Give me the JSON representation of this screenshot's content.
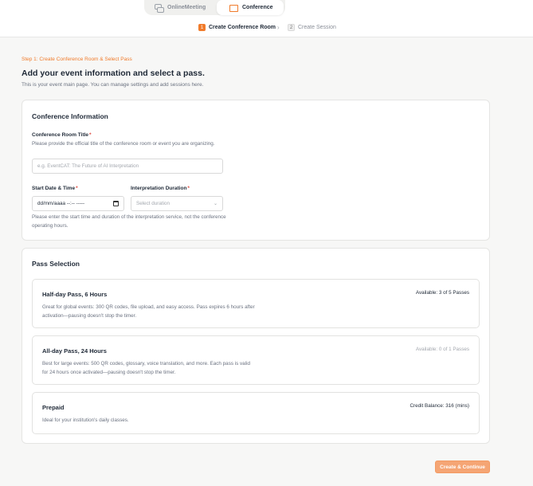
{
  "header": {
    "tabs": [
      {
        "label": "OnlineMeeting",
        "icon": "chat-icon",
        "active": false
      },
      {
        "label": "Conference",
        "icon": "conference-icon",
        "active": true
      }
    ],
    "steps": [
      {
        "number": "1",
        "label": "Create Conference Room",
        "active": true
      },
      {
        "number": "2",
        "label": "Create Session",
        "active": false
      }
    ],
    "step_separator": "›"
  },
  "intro": {
    "step_caption": "Step 1: Create Conference Room & Select Pass",
    "title": "Add your event information and select a pass.",
    "subtitle": "This is your event main page. You can manage settings and add sessions here."
  },
  "conference_info": {
    "title": "Conference Information",
    "room_title_label": "Conference Room Title",
    "required_mark": "*",
    "room_title_help": "Please provide the official title of the conference room or event you are organizing.",
    "room_title_placeholder": "e.g. EventCAT: The Future of AI Interpretation",
    "start_label": "Start Date & Time",
    "start_value": "dd/mm/aaaa  --:-- -----",
    "duration_label": "Interpretation Duration",
    "duration_placeholder": "Select duration",
    "duration_help": "Please enter the start time and duration of the interpretation service, not the conference operating hours."
  },
  "pass_selection": {
    "title": "Pass Selection",
    "passes": [
      {
        "name": "Half-day Pass, 6 Hours",
        "description": "Great for global events: 300 QR codes, file upload, and easy access. Pass expires 6 hours after activation—pausing doesn't stop the timer.",
        "availability": "Available: 3 of 5 Passes",
        "enabled": true
      },
      {
        "name": "All-day Pass, 24 Hours",
        "description": "Best for large events: 500 QR codes, glossary, voice translation, and more. Each pass is valid for 24 hours once activated—pausing doesn't stop the timer.",
        "availability": "Available: 0 of 1 Passes",
        "enabled": false
      },
      {
        "name": "Prepaid",
        "description": "Ideal for your institution's daily classes.",
        "availability": "Credit Balance: 316 (mins)",
        "enabled": true
      }
    ]
  },
  "footer": {
    "continue_label": "Create & Continue"
  },
  "colors": {
    "accent": "#f07b2b",
    "button": "#f5a574",
    "required": "#e0483d"
  }
}
